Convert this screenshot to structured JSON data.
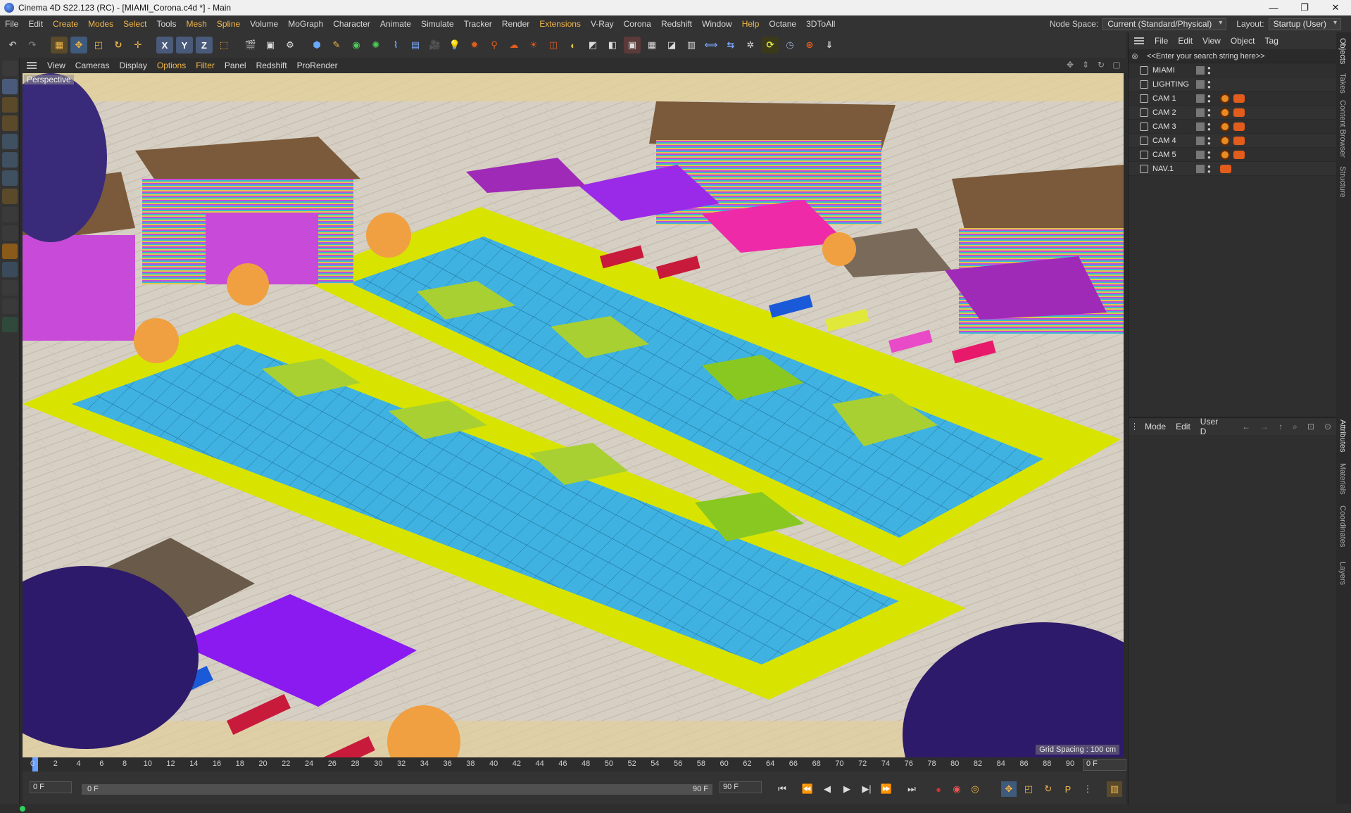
{
  "window": {
    "title": "Cinema 4D S22.123 (RC) - [MIAMI_Corona.c4d *] - Main",
    "controls": [
      "—",
      "❐",
      "✕"
    ]
  },
  "menu": {
    "items": [
      "File",
      "Edit",
      "Create",
      "Modes",
      "Select",
      "Tools",
      "Mesh",
      "Spline",
      "Volume",
      "MoGraph",
      "Character",
      "Animate",
      "Simulate",
      "Tracker",
      "Render",
      "Extensions",
      "V-Ray",
      "Corona",
      "Redshift",
      "Window",
      "Help",
      "Octane",
      "3DToAll"
    ],
    "node_space_label": "Node Space:",
    "node_space_value": "Current (Standard/Physical)",
    "layout_label": "Layout:",
    "layout_value": "Startup (User)"
  },
  "viewport": {
    "menu": [
      "View",
      "Cameras",
      "Display",
      "Options",
      "Filter",
      "Panel",
      "Redshift",
      "ProRender"
    ],
    "label": "Perspective",
    "grid_spacing": "Grid Spacing : 100 cm"
  },
  "objects": {
    "menu": [
      "File",
      "Edit",
      "View",
      "Object",
      "Tag"
    ],
    "search_placeholder": "<<Enter your search string here>>",
    "items": [
      {
        "name": "MIAMI"
      },
      {
        "name": "LIGHTING"
      },
      {
        "name": "CAM 1"
      },
      {
        "name": "CAM 2"
      },
      {
        "name": "CAM 3"
      },
      {
        "name": "CAM 4"
      },
      {
        "name": "CAM 5"
      },
      {
        "name": "NAV.1"
      }
    ]
  },
  "attributes": {
    "menu": [
      "Mode",
      "Edit",
      "User D"
    ]
  },
  "side_tabs": [
    "Objects",
    "Takes",
    "Content Browser",
    "Structure",
    "Attributes",
    "Materials",
    "Coordinates",
    "Layers"
  ],
  "timeline": {
    "ticks": [
      "0",
      "2",
      "4",
      "6",
      "8",
      "10",
      "12",
      "14",
      "16",
      "18",
      "20",
      "22",
      "24",
      "26",
      "28",
      "30",
      "32",
      "34",
      "36",
      "38",
      "40",
      "42",
      "44",
      "46",
      "48",
      "50",
      "52",
      "54",
      "56",
      "58",
      "60",
      "62",
      "64",
      "66",
      "68",
      "70",
      "72",
      "74",
      "76",
      "78",
      "80",
      "82",
      "84",
      "86",
      "88",
      "90"
    ],
    "current_frame": "0 F",
    "start": "0 F",
    "range_start": "0 F",
    "range_end": "90 F",
    "end": "90 F"
  }
}
